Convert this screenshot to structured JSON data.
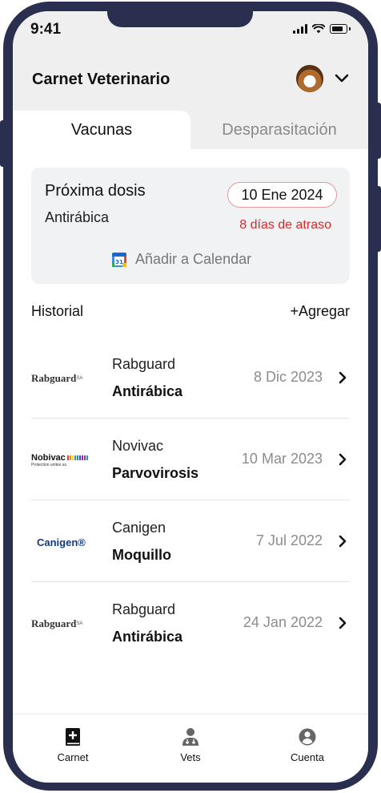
{
  "status_bar": {
    "time": "9:41"
  },
  "header": {
    "title": "Carnet Veterinario"
  },
  "tabs": [
    {
      "label": "Vacunas",
      "active": true
    },
    {
      "label": "Desparasitación",
      "active": false
    }
  ],
  "next_dose": {
    "title": "Próxima dosis",
    "vaccine": "Antirábica",
    "date": "10 Ene 2024",
    "overdue_text": "8 días de atraso",
    "calendar_label": "Añadir a Calendar"
  },
  "history": {
    "label": "Historial",
    "add_label": "+Agregar",
    "items": [
      {
        "logo": "Rabguard",
        "logo_mark": "SA",
        "brand": "Rabguard",
        "vaccine": "Antirábica",
        "date": "8 Dic 2023"
      },
      {
        "logo": "Nobivac",
        "logo_sub": "Protection unites us.",
        "brand": "Novivac",
        "vaccine": "Parvovirosis",
        "date": "10 Mar 2023"
      },
      {
        "logo": "Canigen®",
        "brand": "Canigen",
        "vaccine": "Moquillo",
        "date": "7 Jul 2022"
      },
      {
        "logo": "Rabguard",
        "logo_mark": "SA",
        "brand": "Rabguard",
        "vaccine": "Antirábica",
        "date": "24 Jan 2022"
      }
    ]
  },
  "bottom_nav": [
    {
      "label": "Carnet",
      "icon": "book-plus-icon",
      "active": true
    },
    {
      "label": "Vets",
      "icon": "doctor-icon",
      "active": false
    },
    {
      "label": "Cuenta",
      "icon": "account-icon",
      "active": false
    }
  ],
  "colors": {
    "frame": "#2b2f4f",
    "overdue": "#d62a2a",
    "pill_border": "#e49a9a",
    "muted": "#8c8c8c"
  }
}
